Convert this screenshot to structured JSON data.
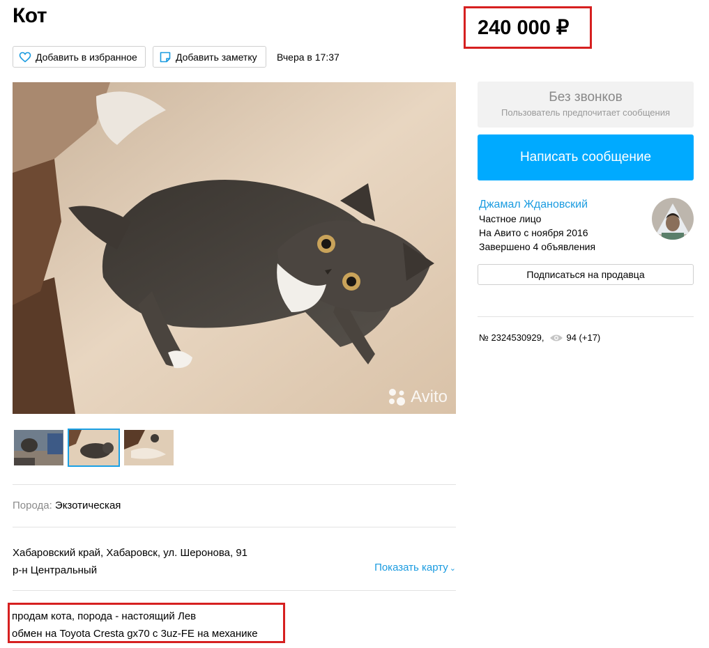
{
  "listing": {
    "title": "Кот",
    "price": "240 000 ₽",
    "date": "Вчера в 17:37",
    "description": [
      "продам кота, порода - настоящий Лев",
      "обмен на Toyota Cresta gx70 с 3uz-FE на механике"
    ]
  },
  "actions": {
    "favorite_label": "Добавить в избранное",
    "note_label": "Добавить заметку"
  },
  "gallery": {
    "watermark": "Avito",
    "active_thumb_index": 1,
    "thumb_count": 3
  },
  "params": {
    "breed_label": "Порода:",
    "breed_value": "Экзотическая"
  },
  "location": {
    "line1": "Хабаровский край, Хабаровск, ул. Шеронова, 91",
    "line2": "р-н Центральный",
    "map_link": "Показать карту"
  },
  "contact": {
    "no_calls_title": "Без звонков",
    "no_calls_sub": "Пользователь предпочитает сообщения",
    "message_button": "Написать сообщение"
  },
  "seller": {
    "name": "Джамал Ждановский",
    "type": "Частное лицо",
    "since": "На Авито с ноября 2016",
    "completed": "Завершено 4 объявления",
    "subscribe_label": "Подписаться на продавца"
  },
  "stats": {
    "ad_number": "№ 2324530929,",
    "views": "94 (+17)"
  },
  "colors": {
    "accent_blue": "#00aaff",
    "link_blue": "#1a9be0",
    "highlight_red": "#d62020",
    "active_thumb_border": "#1aa0e4"
  },
  "icons": {
    "favorite": "heart-icon",
    "note": "note-icon",
    "views": "eye-icon",
    "map": "chevron-down-icon"
  }
}
